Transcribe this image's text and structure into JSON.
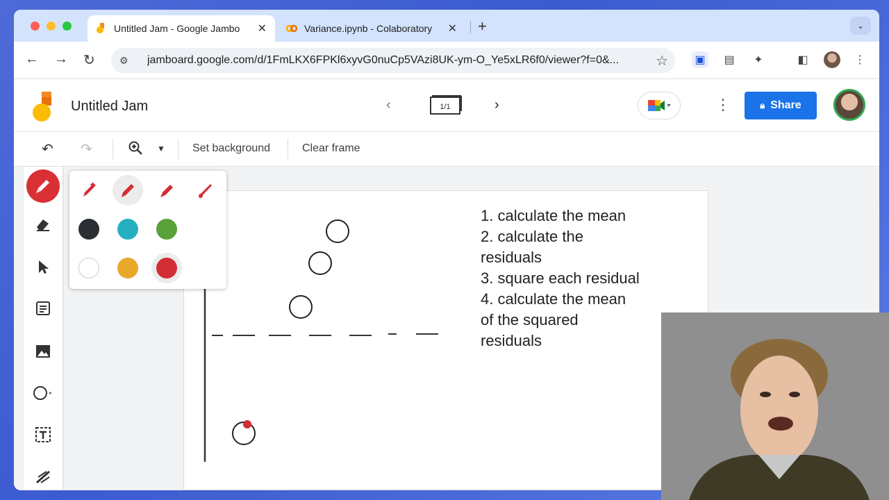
{
  "browser": {
    "tabs": [
      {
        "title": "Untitled Jam - Google Jambo",
        "active": true
      },
      {
        "title": "Variance.ipynb - Colaboratory",
        "active": false
      }
    ],
    "url": "jamboard.google.com/d/1FmLKX6FPKl6xyvG0nuCp5VAzi8UK-ym-O_Ye5xLR6f0/viewer?f=0&..."
  },
  "app": {
    "title": "Untitled Jam",
    "frame_counter": "1/1",
    "share_label": "Share"
  },
  "toolbar": {
    "set_background": "Set background",
    "clear_frame": "Clear frame"
  },
  "board": {
    "steps": [
      "1. calculate the mean",
      "2. calculate the",
      "residuals",
      "3. square each residual",
      "4. calculate the mean",
      "of the squared",
      "residuals"
    ]
  },
  "palette": {
    "colors": [
      "#2b2f33",
      "#26b0bf",
      "#5aa13a",
      "#ffffff",
      "#e9a82a",
      "#d22e35"
    ],
    "selected_color": "#d22e35"
  },
  "colors": {
    "accent": "#1a73e8",
    "pen_active": "#d93036"
  }
}
